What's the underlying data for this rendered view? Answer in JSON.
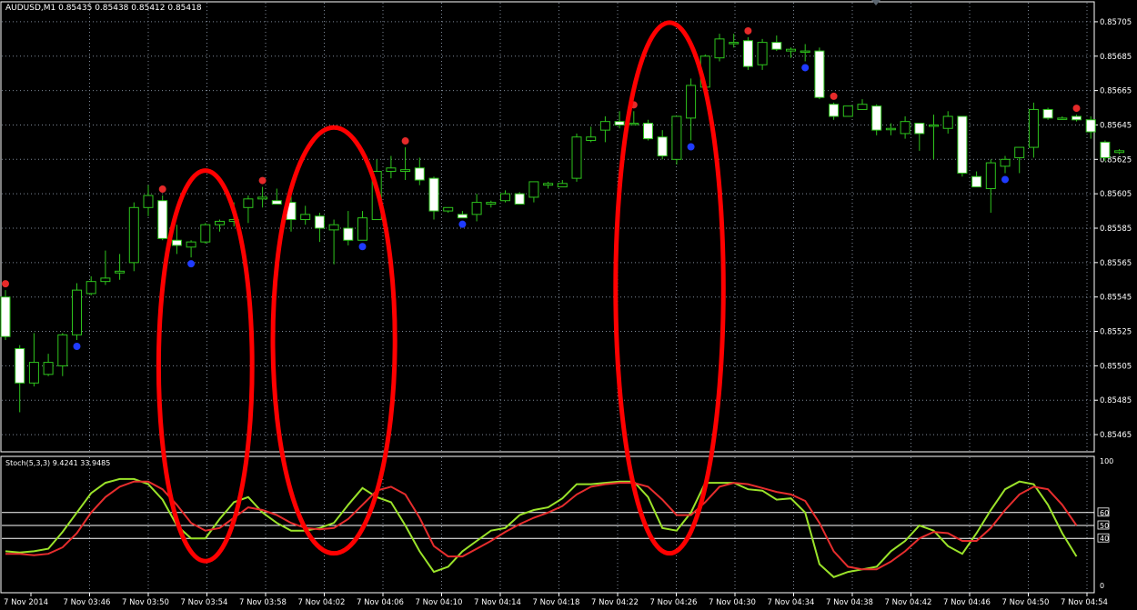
{
  "header": {
    "title": "AUDUSD,M1 0.85435 0.85438 0.85412 0.85418"
  },
  "stoch": {
    "title": "Stoch(5,3,3) 9.4241 33.9485"
  },
  "colors": {
    "background": "#000000",
    "bull_candle": "#000000",
    "bear_candle": "#ffffff",
    "wick": "#2ec41d",
    "main_line": "#9be32a",
    "signal_line": "#e62d2d",
    "buy_dot": "#1f3bff",
    "sell_dot": "#e62a2a",
    "highlight_ellipse": "#ff0000"
  },
  "chart_data": [
    {
      "type": "candlestick",
      "title": "AUDUSD,M1",
      "ylim": [
        0.85455,
        0.85715
      ],
      "y_ticks": [
        "0.85705",
        "0.85685",
        "0.85665",
        "0.85645",
        "0.85625",
        "0.85605",
        "0.85585",
        "0.85565",
        "0.85545",
        "0.85525",
        "0.85505",
        "0.85485",
        "0.85465"
      ],
      "x_labels": [
        "7 Nov 2014",
        "7 Nov 03:46",
        "7 Nov 03:50",
        "7 Nov 03:54",
        "7 Nov 03:58",
        "7 Nov 04:02",
        "7 Nov 04:06",
        "7 Nov 04:10",
        "7 Nov 04:14",
        "7 Nov 04:18",
        "7 Nov 04:22",
        "7 Nov 04:26",
        "7 Nov 04:30",
        "7 Nov 04:34",
        "7 Nov 04:38",
        "7 Nov 04:42",
        "7 Nov 04:46",
        "7 Nov 04:50",
        "7 Nov 04:54"
      ],
      "ohlc": [
        [
          0.85545,
          0.85549,
          0.8552,
          0.85522
        ],
        [
          0.85515,
          0.85517,
          0.85478,
          0.85495
        ],
        [
          0.85495,
          0.85524,
          0.85493,
          0.85507
        ],
        [
          0.855,
          0.85512,
          0.85499,
          0.85507
        ],
        [
          0.85505,
          0.85524,
          0.85499,
          0.85523
        ],
        [
          0.85523,
          0.85553,
          0.8552,
          0.85549
        ],
        [
          0.85547,
          0.85557,
          0.85546,
          0.85554
        ],
        [
          0.85554,
          0.85572,
          0.85552,
          0.85556
        ],
        [
          0.85559,
          0.8557,
          0.85555,
          0.8556
        ],
        [
          0.85565,
          0.856,
          0.8556,
          0.85597
        ],
        [
          0.85597,
          0.8561,
          0.85592,
          0.85604
        ],
        [
          0.85601,
          0.85604,
          0.85578,
          0.85579
        ],
        [
          0.85578,
          0.85587,
          0.8557,
          0.85575
        ],
        [
          0.85574,
          0.85578,
          0.85568,
          0.85577
        ],
        [
          0.85577,
          0.85588,
          0.85576,
          0.85587
        ],
        [
          0.85587,
          0.8559,
          0.85583,
          0.85589
        ],
        [
          0.85589,
          0.856,
          0.85586,
          0.8559
        ],
        [
          0.85597,
          0.85604,
          0.85588,
          0.85602
        ],
        [
          0.85602,
          0.85609,
          0.85597,
          0.85603
        ],
        [
          0.85601,
          0.85608,
          0.85599,
          0.85599
        ],
        [
          0.856,
          0.85608,
          0.85583,
          0.8559
        ],
        [
          0.8559,
          0.85598,
          0.85587,
          0.85593
        ],
        [
          0.85592,
          0.85594,
          0.85577,
          0.85585
        ],
        [
          0.85584,
          0.8559,
          0.85564,
          0.85587
        ],
        [
          0.85585,
          0.85595,
          0.85575,
          0.85578
        ],
        [
          0.85578,
          0.85595,
          0.85578,
          0.85591
        ],
        [
          0.8559,
          0.85625,
          0.8559,
          0.85618
        ],
        [
          0.85618,
          0.85627,
          0.85614,
          0.8562
        ],
        [
          0.85618,
          0.85632,
          0.85613,
          0.85619
        ],
        [
          0.8562,
          0.85626,
          0.8561,
          0.85613
        ],
        [
          0.85614,
          0.85615,
          0.8559,
          0.85595
        ],
        [
          0.85595,
          0.85597,
          0.85594,
          0.85597
        ],
        [
          0.85593,
          0.85595,
          0.85591,
          0.85591
        ],
        [
          0.85593,
          0.85605,
          0.85589,
          0.856
        ],
        [
          0.85599,
          0.85601,
          0.85597,
          0.856
        ],
        [
          0.85601,
          0.85607,
          0.856,
          0.85605
        ],
        [
          0.85605,
          0.85606,
          0.85599,
          0.85599
        ],
        [
          0.85603,
          0.85612,
          0.856,
          0.85612
        ],
        [
          0.8561,
          0.85612,
          0.85608,
          0.85611
        ],
        [
          0.85609,
          0.85613,
          0.85609,
          0.85611
        ],
        [
          0.85614,
          0.8564,
          0.85612,
          0.85638
        ],
        [
          0.85636,
          0.85644,
          0.85635,
          0.85638
        ],
        [
          0.85642,
          0.8565,
          0.85635,
          0.85647
        ],
        [
          0.85647,
          0.85653,
          0.85643,
          0.85645
        ],
        [
          0.85646,
          0.85653,
          0.85646,
          0.85646
        ],
        [
          0.85646,
          0.85648,
          0.85636,
          0.85637
        ],
        [
          0.85638,
          0.85642,
          0.85625,
          0.85627
        ],
        [
          0.85625,
          0.8565,
          0.85622,
          0.8565
        ],
        [
          0.85649,
          0.85672,
          0.85636,
          0.85668
        ],
        [
          0.85667,
          0.85686,
          0.85664,
          0.85685
        ],
        [
          0.85684,
          0.85698,
          0.85682,
          0.85695
        ],
        [
          0.85693,
          0.85698,
          0.8569,
          0.85693
        ],
        [
          0.85694,
          0.85696,
          0.85677,
          0.85679
        ],
        [
          0.8568,
          0.85695,
          0.85677,
          0.85693
        ],
        [
          0.85693,
          0.85697,
          0.85688,
          0.85689
        ],
        [
          0.85688,
          0.8569,
          0.85684,
          0.85689
        ],
        [
          0.85688,
          0.85692,
          0.85682,
          0.85688
        ],
        [
          0.85688,
          0.8569,
          0.8566,
          0.85661
        ],
        [
          0.85657,
          0.85658,
          0.85648,
          0.8565
        ],
        [
          0.8565,
          0.85656,
          0.8565,
          0.85656
        ],
        [
          0.85654,
          0.8566,
          0.85654,
          0.85657
        ],
        [
          0.85656,
          0.85657,
          0.85639,
          0.85642
        ],
        [
          0.85643,
          0.85646,
          0.85639,
          0.85643
        ],
        [
          0.8564,
          0.8565,
          0.85637,
          0.85647
        ],
        [
          0.85646,
          0.85646,
          0.8563,
          0.8564
        ],
        [
          0.85645,
          0.85651,
          0.85625,
          0.85645
        ],
        [
          0.85643,
          0.85653,
          0.8564,
          0.8565
        ],
        [
          0.8565,
          0.8565,
          0.85615,
          0.85617
        ],
        [
          0.85615,
          0.85618,
          0.8561,
          0.85609
        ],
        [
          0.85608,
          0.85625,
          0.85594,
          0.85623
        ],
        [
          0.85621,
          0.85627,
          0.85617,
          0.85625
        ],
        [
          0.85626,
          0.85632,
          0.85617,
          0.85632
        ],
        [
          0.85632,
          0.85658,
          0.85626,
          0.85654
        ],
        [
          0.85654,
          0.85655,
          0.85648,
          0.85649
        ],
        [
          0.85649,
          0.8565,
          0.85648,
          0.85649
        ],
        [
          0.8565,
          0.85651,
          0.85647,
          0.85648
        ],
        [
          0.85648,
          0.8565,
          0.85637,
          0.85641
        ],
        [
          0.85635,
          0.85636,
          0.85624,
          0.85626
        ],
        [
          0.85629,
          0.85631,
          0.85628,
          0.8563
        ]
      ],
      "sell_signals": [
        0,
        11,
        18,
        28,
        44,
        52,
        58,
        75
      ],
      "buy_signals": [
        5,
        13,
        25,
        32,
        48,
        56,
        70
      ],
      "highlighted_regions": [
        [
          12,
          16
        ],
        [
          20,
          26
        ],
        [
          44,
          49
        ]
      ]
    },
    {
      "type": "line",
      "title": "Stoch(5,3,3)",
      "ylim": [
        0,
        100
      ],
      "levels": [
        60,
        50,
        40
      ],
      "y_ticks": [
        "100",
        "60",
        "50",
        "40",
        "0"
      ],
      "series": [
        {
          "name": "main",
          "values": [
            30,
            29,
            30,
            32,
            45,
            60,
            75,
            83,
            86,
            86,
            82,
            70,
            50,
            40,
            40,
            55,
            68,
            72,
            60,
            52,
            46,
            46,
            48,
            52,
            66,
            79,
            72,
            68,
            50,
            30,
            14,
            18,
            30,
            38,
            46,
            48,
            58,
            62,
            64,
            71,
            82,
            82,
            83,
            84,
            84,
            72,
            48,
            46,
            60,
            83,
            83,
            83,
            78,
            77,
            70,
            71,
            60,
            20,
            10,
            14,
            16,
            18,
            30,
            38,
            50,
            46,
            34,
            28,
            44,
            62,
            78,
            84,
            82,
            66,
            44,
            26
          ]
        },
        {
          "name": "signal",
          "values": [
            28,
            28,
            27,
            28,
            33,
            44,
            60,
            72,
            80,
            84,
            84,
            78,
            66,
            52,
            46,
            48,
            56,
            64,
            62,
            58,
            52,
            48,
            47,
            48,
            55,
            66,
            77,
            80,
            74,
            56,
            34,
            26,
            26,
            32,
            38,
            45,
            51,
            56,
            60,
            65,
            74,
            80,
            82,
            83,
            83,
            80,
            70,
            58,
            58,
            68,
            80,
            83,
            82,
            79,
            76,
            74,
            69,
            52,
            30,
            18,
            16,
            16,
            22,
            30,
            40,
            45,
            44,
            38,
            38,
            48,
            62,
            74,
            80,
            78,
            66,
            50
          ]
        }
      ]
    }
  ]
}
